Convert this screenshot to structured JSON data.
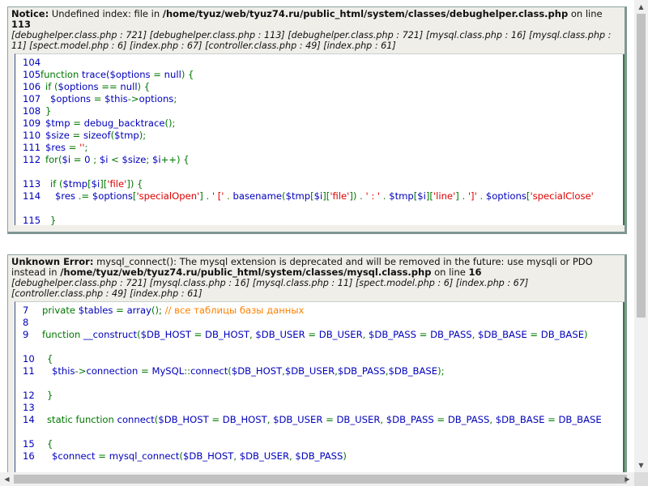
{
  "notice": {
    "label": "Notice:",
    "message_pre": " Undefined index: file in ",
    "path": "/home/tyuz/web/tyuz74.ru/public_html/system/classes/debughelper.class.php",
    "on_line": " on line ",
    "line": "113",
    "trace": "[debughelper.class.php : 721] [debughelper.class.php : 113] [debughelper.class.php : 721] [mysql.class.php : 16] [mysql.class.php : 11] [spect.model.php : 6] [index.php : 67] [controller.class.php : 49] [index.php : 61]",
    "code": [
      {
        "n": "104",
        "indent": 0,
        "parts": []
      },
      {
        "n": "105",
        "indent": 0,
        "parts": [
          [
            "kw",
            "function "
          ],
          [
            "p",
            "trace("
          ],
          [
            "p",
            "$options "
          ],
          [
            "kw",
            "= "
          ],
          [
            "p",
            "null"
          ],
          [
            "kw",
            ") {"
          ]
        ]
      },
      {
        "n": "106",
        "indent": 1,
        "parts": [
          [
            "kw",
            "if ("
          ],
          [
            "p",
            "$options "
          ],
          [
            "kw",
            "== "
          ],
          [
            "p",
            "null"
          ],
          [
            "kw",
            ") {"
          ]
        ]
      },
      {
        "n": "107",
        "indent": 2,
        "parts": [
          [
            "p",
            "$options "
          ],
          [
            "kw",
            "= "
          ],
          [
            "p",
            "$this"
          ],
          [
            "kw",
            "->"
          ],
          [
            "p",
            "options"
          ],
          [
            "kw",
            ";"
          ]
        ]
      },
      {
        "n": "108",
        "indent": 1,
        "parts": [
          [
            "kw",
            "}"
          ]
        ]
      },
      {
        "n": "109",
        "indent": 1,
        "parts": [
          [
            "p",
            "$tmp "
          ],
          [
            "kw",
            "= "
          ],
          [
            "p",
            "debug_backtrace"
          ],
          [
            "kw",
            "();"
          ]
        ]
      },
      {
        "n": "110",
        "indent": 1,
        "parts": [
          [
            "p",
            "$size "
          ],
          [
            "kw",
            "= "
          ],
          [
            "p",
            "sizeof"
          ],
          [
            "kw",
            "("
          ],
          [
            "p",
            "$tmp"
          ],
          [
            "kw",
            ");"
          ]
        ]
      },
      {
        "n": "111",
        "indent": 1,
        "parts": [
          [
            "p",
            "$res "
          ],
          [
            "kw",
            "= "
          ],
          [
            "str",
            "''"
          ],
          [
            "kw",
            ";"
          ]
        ]
      },
      {
        "n": "112",
        "indent": 1,
        "parts": [
          [
            "kw",
            "for("
          ],
          [
            "p",
            "$i "
          ],
          [
            "kw",
            "= "
          ],
          [
            "p",
            "0 "
          ],
          [
            "kw",
            "; "
          ],
          [
            "p",
            "$i "
          ],
          [
            "kw",
            "< "
          ],
          [
            "p",
            "$size"
          ],
          [
            "kw",
            "; "
          ],
          [
            "p",
            "$i"
          ],
          [
            "kw",
            "++) {"
          ]
        ]
      },
      {
        "n": "",
        "indent": 0,
        "parts": [],
        "blank": true
      },
      {
        "n": "113",
        "indent": 2,
        "parts": [
          [
            "kw",
            "if ("
          ],
          [
            "p",
            "$tmp"
          ],
          [
            "kw",
            "["
          ],
          [
            "p",
            "$i"
          ],
          [
            "kw",
            "]["
          ],
          [
            "str",
            "'file'"
          ],
          [
            "kw",
            "]) {"
          ]
        ]
      },
      {
        "n": "114",
        "indent": 3,
        "parts": [
          [
            "p",
            "$res "
          ],
          [
            "kw",
            ".= "
          ],
          [
            "p",
            "$options"
          ],
          [
            "kw",
            "["
          ],
          [
            "str",
            "'specialOpen'"
          ],
          [
            "kw",
            "] . "
          ],
          [
            "str",
            "' ['"
          ],
          [
            "kw",
            " . "
          ],
          [
            "p",
            "basename"
          ],
          [
            "kw",
            "("
          ],
          [
            "p",
            "$tmp"
          ],
          [
            "kw",
            "["
          ],
          [
            "p",
            "$i"
          ],
          [
            "kw",
            "]["
          ],
          [
            "str",
            "'file'"
          ],
          [
            "kw",
            "]) . "
          ],
          [
            "str",
            "' : '"
          ],
          [
            "kw",
            " . "
          ],
          [
            "p",
            "$tmp"
          ],
          [
            "kw",
            "["
          ],
          [
            "p",
            "$i"
          ],
          [
            "kw",
            "]["
          ],
          [
            "str",
            "'line'"
          ],
          [
            "kw",
            "] . "
          ],
          [
            "str",
            "']'"
          ],
          [
            "kw",
            " . "
          ],
          [
            "p",
            "$options"
          ],
          [
            "kw",
            "["
          ],
          [
            "str",
            "'specialClose'"
          ]
        ]
      },
      {
        "n": "",
        "indent": 0,
        "parts": [],
        "blank": true
      },
      {
        "n": "115",
        "indent": 2,
        "parts": [
          [
            "kw",
            "}"
          ]
        ]
      }
    ]
  },
  "error": {
    "label": "Unknown Error:",
    "message_pre": " mysql_connect(): The mysql extension is deprecated and will be removed in the future: use mysqli or PDO instead in ",
    "path": "/home/tyuz/web/tyuz74.ru/public_html/system/classes/mysql.class.php",
    "on_line": " on line ",
    "line": "16",
    "trace": "[debughelper.class.php : 721] [mysql.class.php : 16] [mysql.class.php : 11] [spect.model.php : 6] [index.php : 67] [controller.class.php : 49] [index.php : 61]",
    "code": [
      {
        "n": "7",
        "indent": 0,
        "parts": [
          [
            "kw",
            "private "
          ],
          [
            "p",
            "$tables "
          ],
          [
            "kw",
            "= "
          ],
          [
            "p",
            "array"
          ],
          [
            "kw",
            "(); "
          ],
          [
            "cm",
            "// все таблицы базы данных"
          ]
        ]
      },
      {
        "n": "8",
        "indent": 0,
        "parts": []
      },
      {
        "n": "9",
        "indent": 0,
        "parts": [
          [
            "kw",
            "function "
          ],
          [
            "p",
            "__construct"
          ],
          [
            "kw",
            "("
          ],
          [
            "p",
            "$DB_HOST "
          ],
          [
            "kw",
            "= "
          ],
          [
            "p",
            "DB_HOST"
          ],
          [
            "kw",
            ", "
          ],
          [
            "p",
            "$DB_USER "
          ],
          [
            "kw",
            "= "
          ],
          [
            "p",
            "DB_USER"
          ],
          [
            "kw",
            ", "
          ],
          [
            "p",
            "$DB_PASS "
          ],
          [
            "kw",
            "= "
          ],
          [
            "p",
            "DB_PASS"
          ],
          [
            "kw",
            ", "
          ],
          [
            "p",
            "$DB_BASE "
          ],
          [
            "kw",
            "= "
          ],
          [
            "p",
            "DB_BASE"
          ],
          [
            "kw",
            ")"
          ]
        ]
      },
      {
        "n": "",
        "indent": 0,
        "parts": [],
        "blank": true
      },
      {
        "n": "10",
        "indent": 1,
        "parts": [
          [
            "kw",
            "{"
          ]
        ]
      },
      {
        "n": "11",
        "indent": 2,
        "parts": [
          [
            "p",
            "$this"
          ],
          [
            "kw",
            "->"
          ],
          [
            "p",
            "connection "
          ],
          [
            "kw",
            "= "
          ],
          [
            "p",
            "MySQL"
          ],
          [
            "kw",
            "::"
          ],
          [
            "p",
            "connect"
          ],
          [
            "kw",
            "("
          ],
          [
            "p",
            "$DB_HOST"
          ],
          [
            "kw",
            ","
          ],
          [
            "p",
            "$DB_USER"
          ],
          [
            "kw",
            ","
          ],
          [
            "p",
            "$DB_PASS"
          ],
          [
            "kw",
            ","
          ],
          [
            "p",
            "$DB_BASE"
          ],
          [
            "kw",
            ");"
          ]
        ]
      },
      {
        "n": "",
        "indent": 0,
        "parts": [],
        "blank": true
      },
      {
        "n": "12",
        "indent": 1,
        "parts": [
          [
            "kw",
            "}"
          ]
        ]
      },
      {
        "n": "13",
        "indent": 0,
        "parts": []
      },
      {
        "n": "14",
        "indent": 1,
        "parts": [
          [
            "kw",
            "static function "
          ],
          [
            "p",
            "connect"
          ],
          [
            "kw",
            "("
          ],
          [
            "p",
            "$DB_HOST "
          ],
          [
            "kw",
            "= "
          ],
          [
            "p",
            "DB_HOST"
          ],
          [
            "kw",
            ", "
          ],
          [
            "p",
            "$DB_USER "
          ],
          [
            "kw",
            "= "
          ],
          [
            "p",
            "DB_USER"
          ],
          [
            "kw",
            ", "
          ],
          [
            "p",
            "$DB_PASS "
          ],
          [
            "kw",
            "= "
          ],
          [
            "p",
            "DB_PASS"
          ],
          [
            "kw",
            ", "
          ],
          [
            "p",
            "$DB_BASE "
          ],
          [
            "kw",
            "= "
          ],
          [
            "p",
            "DB_BASE"
          ]
        ]
      },
      {
        "n": "",
        "indent": 0,
        "parts": [],
        "blank": true
      },
      {
        "n": "15",
        "indent": 1,
        "parts": [
          [
            "kw",
            "{"
          ]
        ]
      },
      {
        "n": "16",
        "indent": 2,
        "parts": [
          [
            "p",
            "$connect "
          ],
          [
            "kw",
            "= "
          ],
          [
            "p",
            "mysql_connect"
          ],
          [
            "kw",
            "("
          ],
          [
            "p",
            "$DB_HOST"
          ],
          [
            "kw",
            ", "
          ],
          [
            "p",
            "$DB_USER"
          ],
          [
            "kw",
            ", "
          ],
          [
            "p",
            "$DB_PASS"
          ],
          [
            "kw",
            ")"
          ]
        ]
      }
    ]
  },
  "scrollbars": {
    "up_icon": "triangle-up",
    "down_icon": "triangle-down",
    "left_icon": "triangle-left",
    "right_icon": "triangle-right"
  }
}
